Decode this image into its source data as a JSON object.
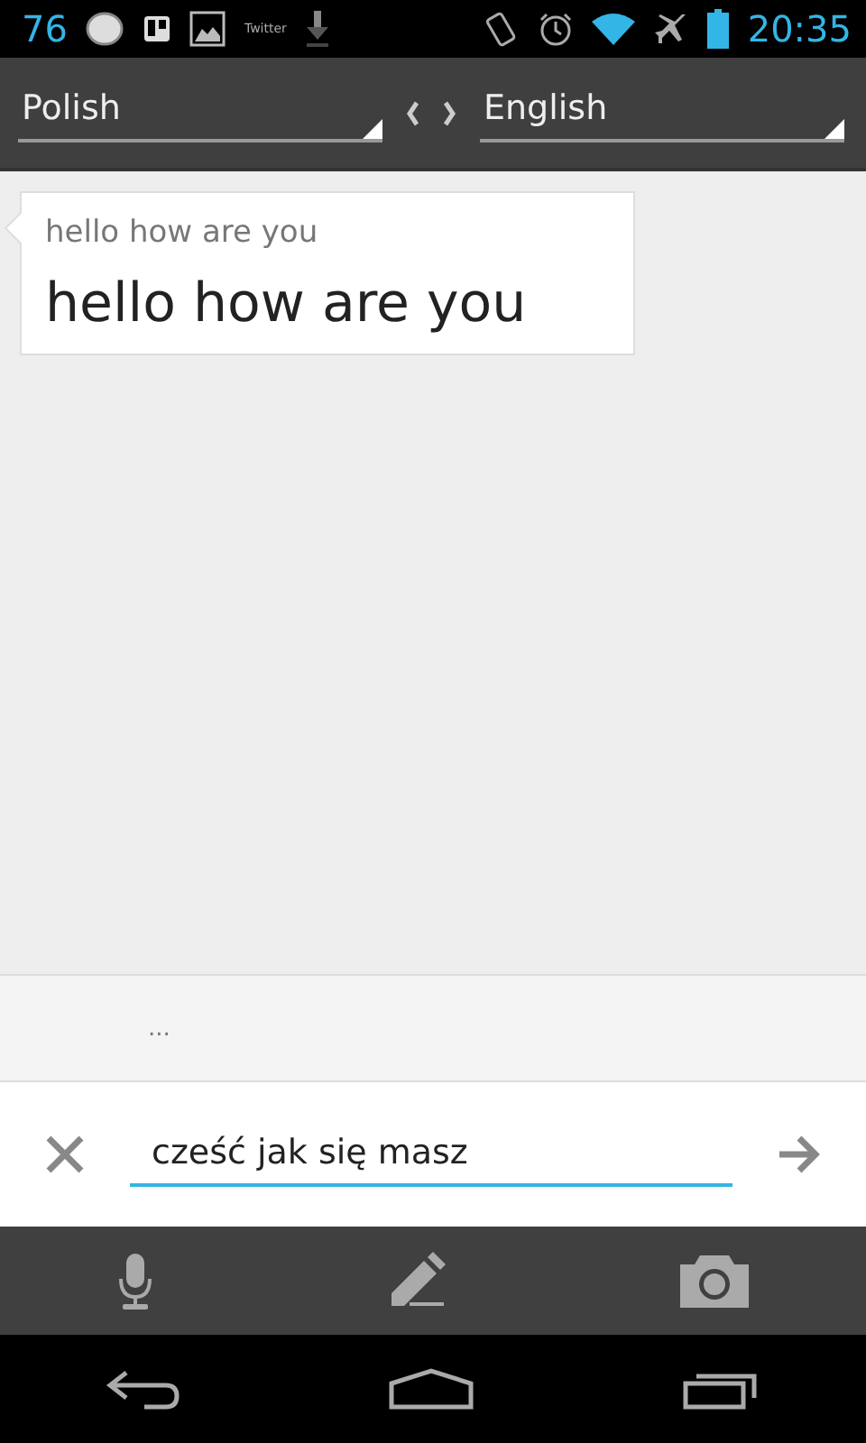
{
  "status_bar": {
    "counter": "76",
    "notification_text": "Twitter",
    "time": "20:35"
  },
  "languages": {
    "source": "Polish",
    "target": "English"
  },
  "result": {
    "original": "hello how are you",
    "translation": "hello how are you"
  },
  "suggestion": "...",
  "input": {
    "value": "cześć jak się masz"
  }
}
